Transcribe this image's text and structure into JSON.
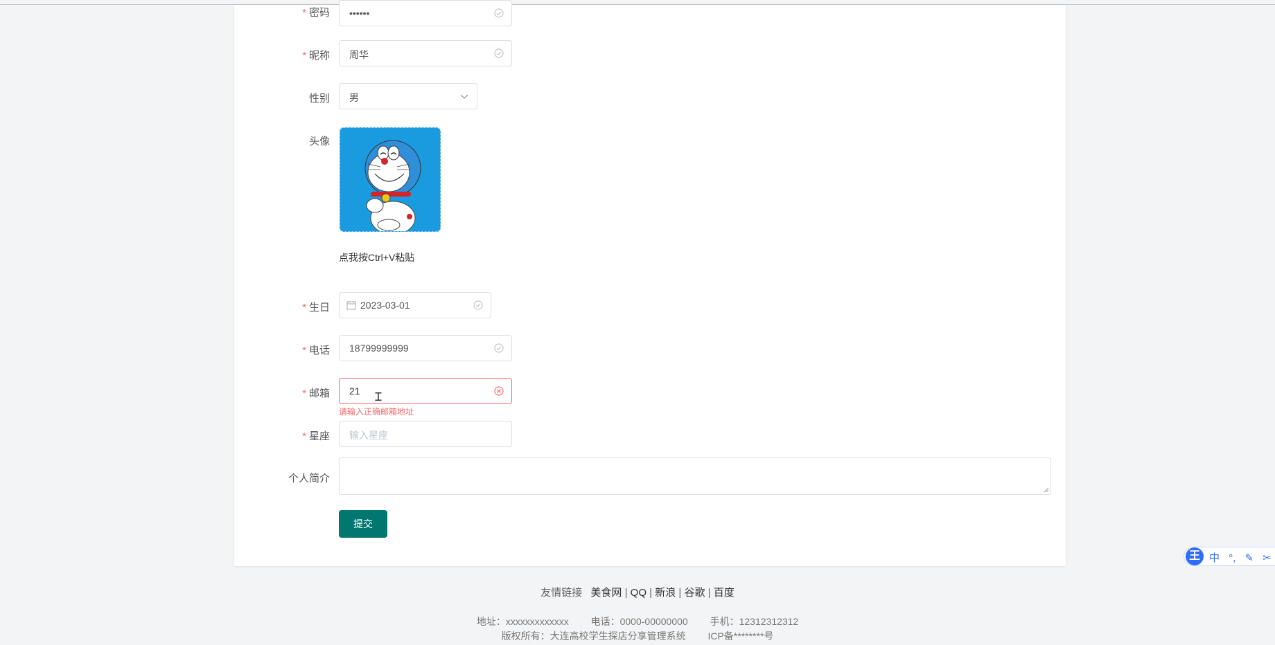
{
  "form": {
    "password": {
      "label": "密码",
      "value": "••••••"
    },
    "nickname": {
      "label": "昵称",
      "value": "周华"
    },
    "gender": {
      "label": "性别",
      "value": "男"
    },
    "avatar": {
      "label": "头像",
      "paste_hint": "点我按Ctrl+V粘贴"
    },
    "birthday": {
      "label": "生日",
      "value": "2023-03-01"
    },
    "phone": {
      "label": "电话",
      "value": "18799999999"
    },
    "email": {
      "label": "邮箱",
      "value": "21",
      "error": "请输入正确邮箱地址"
    },
    "constellation": {
      "label": "星座",
      "placeholder": "输入星座"
    },
    "bio": {
      "label": "个人简介",
      "value": ""
    },
    "submit_label": "提交"
  },
  "footer": {
    "links_label": "友情链接",
    "links": [
      "美食网",
      "QQ",
      "新浪",
      "谷歌",
      "百度"
    ],
    "address": "地址：xxxxxxxxxxxxx",
    "tel": "电话：0000-00000000",
    "mobile": "手机：12312312312",
    "copyright": "版权所有：大连高校学生探店分享管理系统",
    "icp": "ICP备********号"
  },
  "ime_toolbar": {
    "logo": "王",
    "items": [
      "中",
      "°,",
      "✎",
      "✂",
      "⊞"
    ]
  },
  "colors": {
    "accent_button": "#00776f",
    "error": "#f56c6c",
    "valid_icon": "#c0c4cc",
    "avatar_bg": "#1a9be0"
  }
}
